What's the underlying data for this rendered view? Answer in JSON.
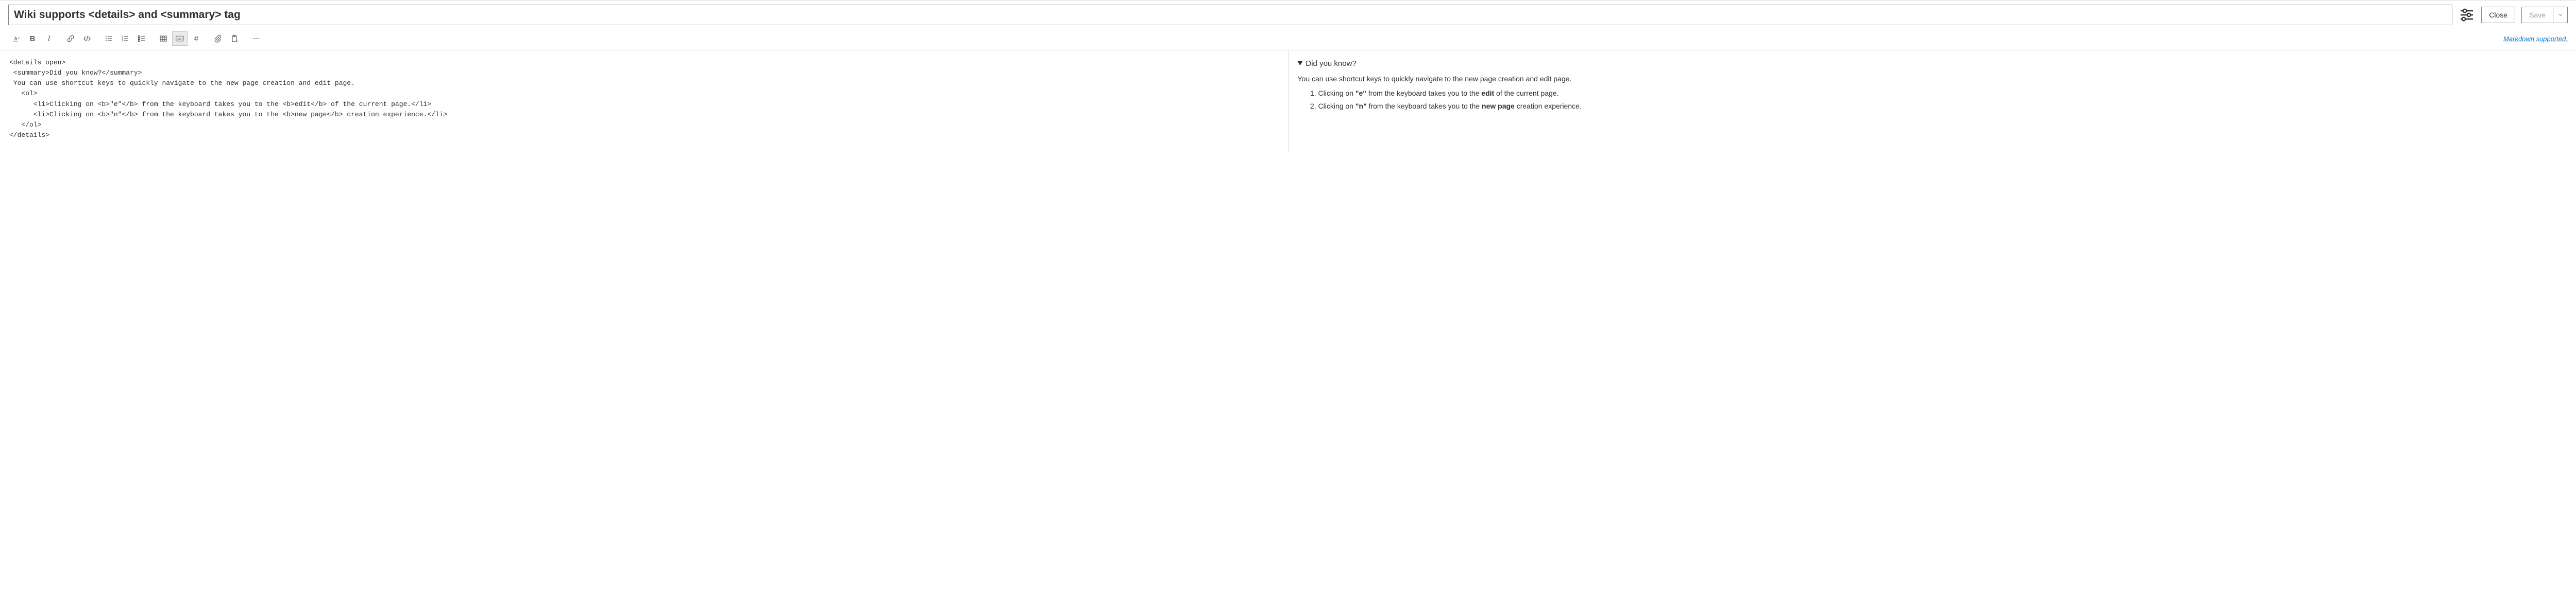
{
  "header": {
    "title_value": "Wiki supports <details> and <summary> tag",
    "close_label": "Close",
    "save_label": "Save"
  },
  "toolbar": {
    "markdown_supported_label": "Markdown supported."
  },
  "source": {
    "l1": "<details open>",
    "l2": " <summary>Did you know?</summary>",
    "l3": " You can use shortcut keys to quickly navigate to the new page creation and edit page.",
    "l4": "   <ol>",
    "l5": "      <li>Clicking on <b>\"e\"</b> from the keyboard takes you to the <b>edit</b> of the current page.</li>",
    "l6": "      <li>Clicking on <b>\"n\"</b> from the keyboard takes you to the <b>new page</b> creation experience.</li>",
    "l7": "   </ol>",
    "l8": "</details>"
  },
  "preview": {
    "summary": "Did you know?",
    "lead": "You can use shortcut keys to quickly navigate to the new page creation and edit page.",
    "li1_a": "Clicking on ",
    "li1_b": "\"e\"",
    "li1_c": " from the keyboard takes you to the ",
    "li1_d": "edit",
    "li1_e": " of the current page.",
    "li2_a": "Clicking on ",
    "li2_b": "\"n\"",
    "li2_c": " from the keyboard takes you to the ",
    "li2_d": "new page",
    "li2_e": " creation experience."
  }
}
